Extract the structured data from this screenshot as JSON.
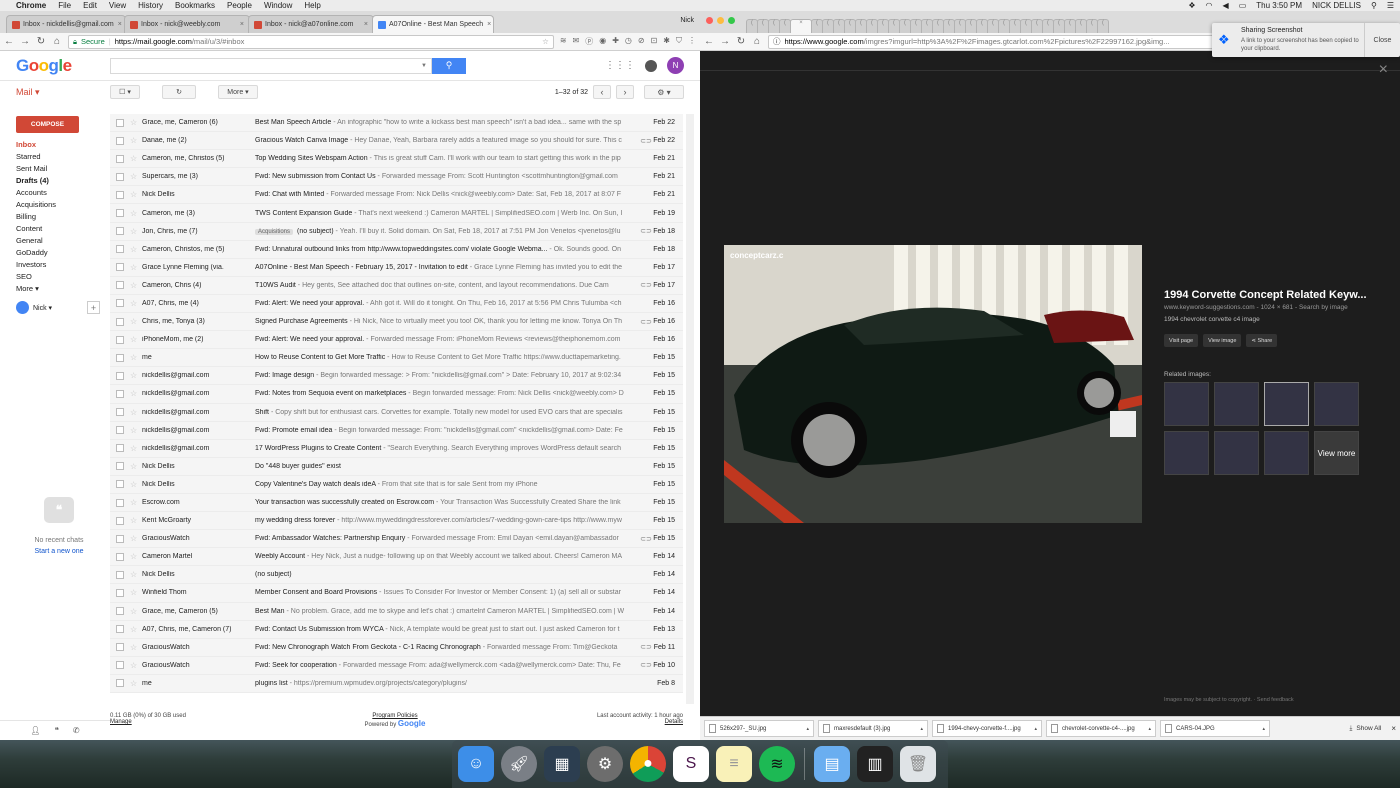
{
  "menubar": {
    "app": "Chrome",
    "items": [
      "File",
      "Edit",
      "View",
      "History",
      "Bookmarks",
      "People",
      "Window",
      "Help"
    ],
    "clock": "Thu 3:50 PM",
    "user": "NICK DELLIS"
  },
  "left_window": {
    "tabs": [
      {
        "label": "Inbox - nickdellis@gmail.com",
        "color": "#d14836"
      },
      {
        "label": "Inbox - nick@weebly.com",
        "color": "#d14836"
      },
      {
        "label": "Inbox - nick@a07online.com",
        "color": "#d14836"
      },
      {
        "label": "A07Online - Best Man Speech",
        "color": "#4285f4"
      }
    ],
    "profile": "Nick",
    "address": {
      "secure": "Secure",
      "host": "https://mail.google.com",
      "path": "/mail/u/3/#inbox"
    },
    "gmail": {
      "logo": "Google",
      "avatar_letter": "N",
      "mail_label": "Mail ▾",
      "more_label": "More ▾",
      "paging": "1–32 of 32",
      "compose": "COMPOSE",
      "labels": [
        {
          "name": "Inbox",
          "style": "active"
        },
        {
          "name": "Starred",
          "style": ""
        },
        {
          "name": "Sent Mail",
          "style": ""
        },
        {
          "name": "Drafts (4)",
          "style": "bold"
        },
        {
          "name": "Accounts",
          "style": ""
        },
        {
          "name": "Acquisitions",
          "style": ""
        },
        {
          "name": "Billing",
          "style": ""
        },
        {
          "name": "Content",
          "style": ""
        },
        {
          "name": "General",
          "style": ""
        },
        {
          "name": "GoDaddy",
          "style": ""
        },
        {
          "name": "Investors",
          "style": ""
        },
        {
          "name": "SEO",
          "style": ""
        },
        {
          "name": "More ▾",
          "style": ""
        }
      ],
      "hangout_user": "Nick ▾",
      "no_chats": "No recent chats",
      "start_chat": "Start a new one",
      "emails": [
        {
          "from": "Grace, me, Cameron (6)",
          "subject": "Best Man Speech Article",
          "snippet": " - An infographic \"how to write a kickass best man speech\" isn't a bad idea... same with the sp",
          "date": "Feb 22",
          "clip": ""
        },
        {
          "from": "Danae, me (2)",
          "subject": "Gracious Watch Canva Image",
          "snippet": " - Hey Danae, Yeah, Barbara rarely adds a featured image so you should for sure. This c",
          "date": "Feb 22",
          "clip": "⊂⊃"
        },
        {
          "from": "Cameron, me, Christos (5)",
          "subject": "Top Wedding Sites Webspam Action",
          "snippet": " - This is great stuff Cam. I'll work with our team to start getting this work in the pip",
          "date": "Feb 21",
          "clip": ""
        },
        {
          "from": "Supercars, me (3)",
          "subject": "Fwd: New submission from Contact Us",
          "snippet": " - Forwarded message From: Scott Huntington <scottmhuntington@gmail.com",
          "date": "Feb 21",
          "clip": ""
        },
        {
          "from": "Nick Dellis",
          "subject": "Fwd: Chat with Minted",
          "snippet": " - Forwarded message From: Nick Dellis <nick@weebly.com> Date: Sat, Feb 18, 2017 at 8:07 F",
          "date": "Feb 21",
          "clip": ""
        },
        {
          "from": "Cameron, me (3)",
          "subject": "TWS Content Expansion Guide",
          "snippet": " - That's next weekend :) Cameron MARTEL | SimplifiedSEO.com | Werb Inc. On Sun, I",
          "date": "Feb 19",
          "clip": ""
        },
        {
          "from": "Jon, Chris, me (7)",
          "label": "Acquisitions",
          "subject": "(no subject)",
          "snippet": " - Yeah. I'll buy it. Solid domain. On Sat, Feb 18, 2017 at 7:51 PM Jon Venetos <jvenetos@lu",
          "date": "Feb 18",
          "clip": "⊂⊃"
        },
        {
          "from": "Cameron, Christos, me (5)",
          "subject": "Fwd: Unnatural outbound links from http://www.topweddingsites.com/ violate Google Webma...",
          "snippet": " - Ok. Sounds good. On",
          "date": "Feb 18",
          "clip": ""
        },
        {
          "from": "Grace Lynne Fleming (via.",
          "subject": "A07Online - Best Man Speech - February 15, 2017 - Invitation to edit",
          "snippet": " - Grace Lynne Fleming has invited you to edit the",
          "date": "Feb 17",
          "clip": ""
        },
        {
          "from": "Cameron, Chris (4)",
          "subject": "T10WS Audit",
          "snippet": " - Hey gents, See attached doc that outlines on-site, content, and layout recommendations. Due Cam",
          "date": "Feb 17",
          "clip": "⊂⊃"
        },
        {
          "from": "A07, Chris, me (4)",
          "subject": "Fwd: Alert: We need your approval.",
          "snippet": " - Ahh got it. Will do it tonight. On Thu, Feb 16, 2017 at 5:56 PM Chris Tulumba <ch",
          "date": "Feb 16",
          "clip": ""
        },
        {
          "from": "Chris, me, Tonya (3)",
          "subject": "Signed Purchase Agreements",
          "snippet": " - Hi Nick, Nice to virtually meet you too! OK, thank you for letting me know. Tonya On Th",
          "date": "Feb 16",
          "clip": "⊂⊃"
        },
        {
          "from": "iPhoneMom, me (2)",
          "subject": "Fwd: Alert: We need your approval.",
          "snippet": " - Forwarded message From: iPhoneMom Reviews <reviews@theiphonemom.com",
          "date": "Feb 16",
          "clip": ""
        },
        {
          "from": "me",
          "subject": "How to Reuse Content to Get More Traffic",
          "snippet": " - How to Reuse Content to Get More Traffic https://www.ducttapemarketing.",
          "date": "Feb 15",
          "clip": ""
        },
        {
          "from": "nickdellis@gmail.com",
          "subject": "Fwd: Image design",
          "snippet": " - Begin forwarded message: > From: \"nickdellis@gmail.com\" > Date: February 10, 2017 at 9:02:34",
          "date": "Feb 15",
          "clip": ""
        },
        {
          "from": "nickdellis@gmail.com",
          "subject": "Fwd: Notes from Sequoia event on marketplaces",
          "snippet": " - Begin forwarded message: From: Nick Dellis <nick@weebly.com> D",
          "date": "Feb 15",
          "clip": ""
        },
        {
          "from": "nickdellis@gmail.com",
          "subject": "Shift",
          "snippet": " - Copy shift but for enthusiast cars. Corvettes for example. Totally new model for used EVO cars that are specialis",
          "date": "Feb 15",
          "clip": ""
        },
        {
          "from": "nickdellis@gmail.com",
          "subject": "Fwd: Promote email idea",
          "snippet": " - Begin forwarded message: From: \"nickdellis@gmail.com\" <nickdellis@gmail.com> Date: Fe",
          "date": "Feb 15",
          "clip": ""
        },
        {
          "from": "nickdellis@gmail.com",
          "subject": "17 WordPress Plugins to Create Content",
          "snippet": " - \"Search Everything. Search Everything improves WordPress default search",
          "date": "Feb 15",
          "clip": ""
        },
        {
          "from": "Nick Dellis",
          "subject": "Do \"448 buyer guides\" exist",
          "snippet": "",
          "date": "Feb 15",
          "clip": ""
        },
        {
          "from": "Nick Dellis",
          "subject": "Copy Valentine's Day watch deals ideA",
          "snippet": " - From that site that is for sale Sent from my iPhone",
          "date": "Feb 15",
          "clip": ""
        },
        {
          "from": "Escrow.com",
          "subject": "Your transaction was successfully created on Escrow.com",
          "snippet": " - Your Transaction Was Successfully Created Share the link",
          "date": "Feb 15",
          "clip": ""
        },
        {
          "from": "Kent McGroarty",
          "subject": "my wedding dress forever",
          "snippet": " - http://www.myweddingdressforever.com/articles/7-wedding-gown-care-tips http://www.myw",
          "date": "Feb 15",
          "clip": ""
        },
        {
          "from": "GraciousWatch",
          "subject": "Fwd: Ambassador Watches: Partnership Enquiry",
          "snippet": " - Forwarded message From: Emil Dayan <emil.dayan@ambassador",
          "date": "Feb 15",
          "clip": "⊂⊃"
        },
        {
          "from": "Cameron Martel",
          "subject": "Weebly Account",
          "snippet": " - Hey Nick, Just a nudge- following up on that Weebly account we talked about. Cheers! Cameron MA",
          "date": "Feb 14",
          "clip": ""
        },
        {
          "from": "Nick Dellis",
          "subject": "(no subject)",
          "snippet": "",
          "date": "Feb 14",
          "clip": ""
        },
        {
          "from": "Winfield Thom",
          "subject": "Member Consent and Board Provisions",
          "snippet": " - Issues To Consider For Investor or Member Consent: 1) (a) sell all or substar",
          "date": "Feb 14",
          "clip": ""
        },
        {
          "from": "Grace, me, Cameron (5)",
          "subject": "Best Man",
          "snippet": " - No problem. Grace, add me to skype and let's chat :) cmartelnf Cameron MARTEL | SimplifiedSEO.com | W",
          "date": "Feb 14",
          "clip": ""
        },
        {
          "from": "A07, Chris, me, Cameron (7)",
          "subject": "Fwd: Contact Us Submission from WYCA",
          "snippet": " - Nick, A template would be great just to start out. I just asked Cameron for t",
          "date": "Feb 13",
          "clip": ""
        },
        {
          "from": "GraciousWatch",
          "subject": "Fwd: New Chronograph Watch From Geckota - C-1 Racing Chronograph",
          "snippet": " - Forwarded message From: Tim@Geckota",
          "date": "Feb 11",
          "clip": "⊂⊃"
        },
        {
          "from": "GraciousWatch",
          "subject": "Fwd: Seek for cooperation",
          "snippet": " - Forwarded message From: ada@wellymerck.com <ada@wellymerck.com> Date: Thu, Fe",
          "date": "Feb 10",
          "clip": "⊂⊃"
        },
        {
          "from": "me",
          "subject": "plugins list",
          "snippet": " - https://premium.wpmudev.org/projects/category/plugins/",
          "date": "Feb 8",
          "clip": ""
        }
      ],
      "footer": {
        "storage": "0.11 GB (0%) of 30 GB used",
        "manage": "Manage",
        "policies": "Program Policies",
        "powered": "Powered by",
        "google": "Google",
        "activity": "Last account activity: 1 hour ago",
        "details": "Details"
      }
    }
  },
  "right_window": {
    "address": {
      "host": "https://www.google.com",
      "path": "/imgres?imgurl=http%3A%2F%2Fimages.gtcarlot.com%2Fpictures%2F22997162.jpg&img..."
    },
    "notification": {
      "title": "Sharing Screenshot",
      "body": "A link to your screenshot has been copied to your clipboard.",
      "close": "Close"
    },
    "image": {
      "watermark": "conceptcarz.c",
      "title": "1994 Corvette Concept Related Keyw...",
      "meta": "www.keyword-suggestions.com - 1024 × 681 - Search by image",
      "description": "1994 chevrolet corvette c4 image",
      "actions": [
        "Visit page",
        "View image",
        "Share"
      ],
      "related_label": "Related images:",
      "view_more": "View more",
      "copyright": "Images may be subject to copyright. · Send feedback"
    },
    "downloads": [
      "526x297-_SU.jpg",
      "maxresdefault (3).jpg",
      "1994-chevy-corvette-f....jpg",
      "chevrolet-corvette-c4-....jpg",
      "CARS-04.JPG"
    ],
    "show_all": "Show All"
  }
}
